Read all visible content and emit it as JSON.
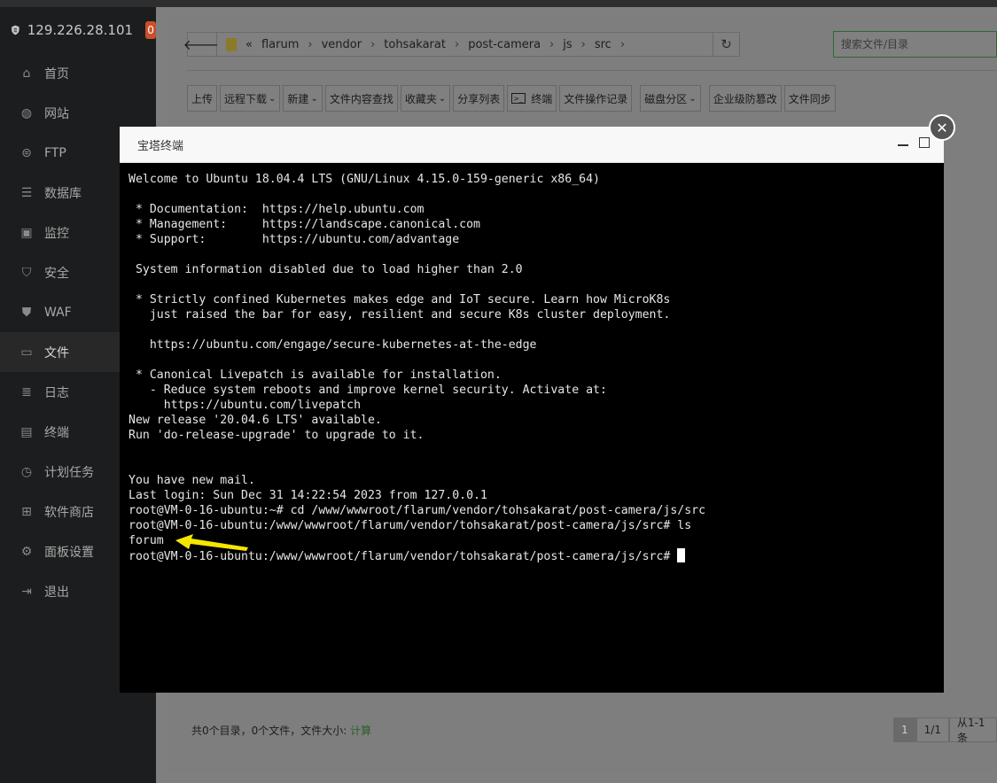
{
  "sidebar": {
    "ip": "129.226.28.101",
    "badge": "0",
    "items": [
      {
        "label": "首页",
        "icon": "home-icon",
        "glyph": "⌂"
      },
      {
        "label": "网站",
        "icon": "globe-icon",
        "glyph": "◍"
      },
      {
        "label": "FTP",
        "icon": "ftp-icon",
        "glyph": "⊜"
      },
      {
        "label": "数据库",
        "icon": "database-icon",
        "glyph": "☰"
      },
      {
        "label": "监控",
        "icon": "monitor-icon",
        "glyph": "▣"
      },
      {
        "label": "安全",
        "icon": "shield-check-icon",
        "glyph": "⛉"
      },
      {
        "label": "WAF",
        "icon": "waf-shield-icon",
        "glyph": "⛊"
      },
      {
        "label": "文件",
        "icon": "folder-icon",
        "glyph": "▭"
      },
      {
        "label": "日志",
        "icon": "log-icon",
        "glyph": "≣"
      },
      {
        "label": "终端",
        "icon": "terminal-icon",
        "glyph": "▤"
      },
      {
        "label": "计划任务",
        "icon": "clock-icon",
        "glyph": "◷"
      },
      {
        "label": "软件商店",
        "icon": "apps-icon",
        "glyph": "⊞"
      },
      {
        "label": "面板设置",
        "icon": "gear-icon",
        "glyph": "⚙"
      },
      {
        "label": "退出",
        "icon": "logout-icon",
        "glyph": "⇥"
      }
    ],
    "active_index": 7
  },
  "filebar": {
    "crumbs": [
      "flarum",
      "vendor",
      "tohsakarat",
      "post-camera",
      "js",
      "src"
    ],
    "search_placeholder": "搜索文件/目录"
  },
  "toolbar": {
    "buttons": [
      {
        "label": "上传",
        "caret": false
      },
      {
        "label": "远程下载",
        "caret": true
      },
      {
        "label": "新建",
        "caret": true
      },
      {
        "label": "文件内容查找",
        "caret": false
      },
      {
        "label": "收藏夹",
        "caret": true
      },
      {
        "label": "分享列表",
        "caret": false
      },
      {
        "label": "终端",
        "caret": false,
        "icon": true
      },
      {
        "label": "文件操作记录",
        "caret": false
      },
      {
        "label": "磁盘分区",
        "caret": true,
        "gap": true
      },
      {
        "label": "企业级防篡改",
        "caret": false,
        "gap": true
      },
      {
        "label": "文件同步",
        "caret": false
      }
    ]
  },
  "footer": {
    "summary": "共0个目录，0个文件，文件大小:",
    "calc": "计算",
    "pager": [
      "1",
      "1/1",
      "从1-1条"
    ]
  },
  "modal": {
    "title": "宝塔终端",
    "lines": [
      "Welcome to Ubuntu 18.04.4 LTS (GNU/Linux 4.15.0-159-generic x86_64)",
      "",
      " * Documentation:  https://help.ubuntu.com",
      " * Management:     https://landscape.canonical.com",
      " * Support:        https://ubuntu.com/advantage",
      "",
      " System information disabled due to load higher than 2.0",
      "",
      " * Strictly confined Kubernetes makes edge and IoT secure. Learn how MicroK8s",
      "   just raised the bar for easy, resilient and secure K8s cluster deployment.",
      "",
      "   https://ubuntu.com/engage/secure-kubernetes-at-the-edge",
      "",
      " * Canonical Livepatch is available for installation.",
      "   - Reduce system reboots and improve kernel security. Activate at:",
      "     https://ubuntu.com/livepatch",
      "New release '20.04.6 LTS' available.",
      "Run 'do-release-upgrade' to upgrade to it.",
      "",
      "",
      "You have new mail.",
      "Last login: Sun Dec 31 14:22:54 2023 from 127.0.0.1",
      "root@VM-0-16-ubuntu:~# cd /www/wwwroot/flarum/vendor/tohsakarat/post-camera/js/src",
      "root@VM-0-16-ubuntu:/www/wwwroot/flarum/vendor/tohsakarat/post-camera/js/src# ls",
      "forum",
      "root@VM-0-16-ubuntu:/www/wwwroot/flarum/vendor/tohsakarat/post-camera/js/src# "
    ]
  },
  "colors": {
    "sidebar_bg": "#1c1d1e",
    "badge": "#c94f2a",
    "arrow": "#f5e600",
    "terminal_bg": "#000000"
  }
}
